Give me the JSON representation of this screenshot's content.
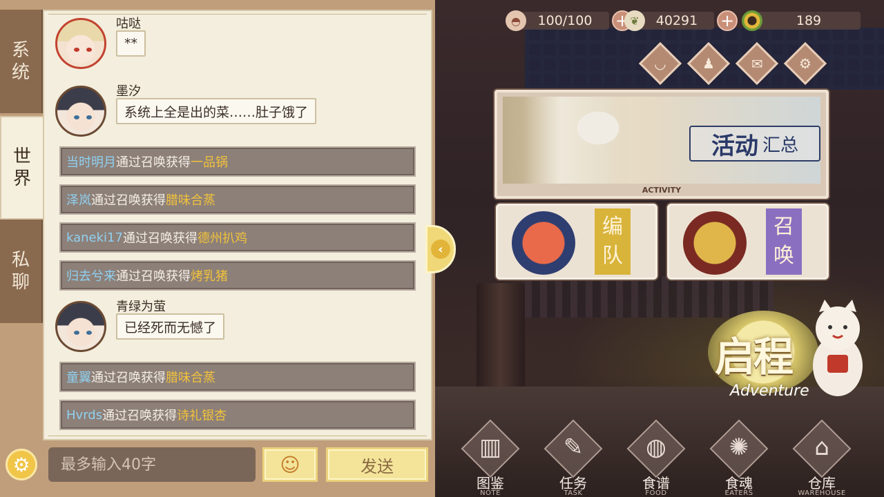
{
  "resources": {
    "stamina": {
      "value": "100/100",
      "icon": "dumpling-icon"
    },
    "coins": {
      "value": "40291",
      "icon": "leaf-coin-icon"
    },
    "gems": {
      "value": "189",
      "icon": "jade-icon"
    }
  },
  "top_icons": [
    "bowl-icon",
    "figure-icon",
    "mail-icon",
    "gear-icon"
  ],
  "activity": {
    "title_main": "活动",
    "title_sub": "汇总",
    "label": "ACTIVITY"
  },
  "cards": {
    "team": {
      "label_1": "编",
      "label_2": "队"
    },
    "summon": {
      "label_1": "召",
      "label_2": "唤"
    }
  },
  "adventure": {
    "title": "启程",
    "subtitle": "Adventure"
  },
  "bottom_nav": [
    {
      "label": "图鉴",
      "sub": "NOTE",
      "icon": "book-icon"
    },
    {
      "label": "任务",
      "sub": "TASK",
      "icon": "task-icon"
    },
    {
      "label": "食谱",
      "sub": "FOOD",
      "icon": "plate-icon"
    },
    {
      "label": "食魂",
      "sub": "EATERS",
      "icon": "soul-icon"
    },
    {
      "label": "仓库",
      "sub": "WAREHOUSE",
      "icon": "warehouse-icon"
    }
  ],
  "side_tabs": [
    {
      "label_1": "系",
      "label_2": "统"
    },
    {
      "label_1": "世",
      "label_2": "界"
    },
    {
      "label_1": "私",
      "label_2": "聊"
    }
  ],
  "messages": [
    {
      "sender": "咕哒",
      "text": "**"
    },
    {
      "sender": "墨汐",
      "text": "系统上全是出的菜……肚子饿了"
    },
    {
      "sender": "青绿为萤",
      "text": "已经死而无憾了"
    }
  ],
  "system_rows": [
    {
      "player": "当时明月",
      "verb": "通过召唤获得",
      "item": "一品锅"
    },
    {
      "player": "泽岚",
      "verb": "通过召唤获得",
      "item": "腊味合蒸"
    },
    {
      "player": "kaneki17",
      "verb": "通过召唤获得",
      "item": "德州扒鸡"
    },
    {
      "player": "归去兮来",
      "verb": "通过召唤获得",
      "item": "烤乳猪"
    },
    {
      "player": "童翼",
      "verb": "通过召唤获得",
      "item": "腊味合蒸"
    },
    {
      "player": "Hvrds",
      "verb": "通过召唤获得",
      "item": "诗礼银杏"
    }
  ],
  "input": {
    "placeholder": "最多输入40字",
    "send_label": "发送"
  },
  "colors": {
    "player": "#8fd0f0",
    "item": "#f2c23a",
    "panel": "#f3eedd"
  }
}
